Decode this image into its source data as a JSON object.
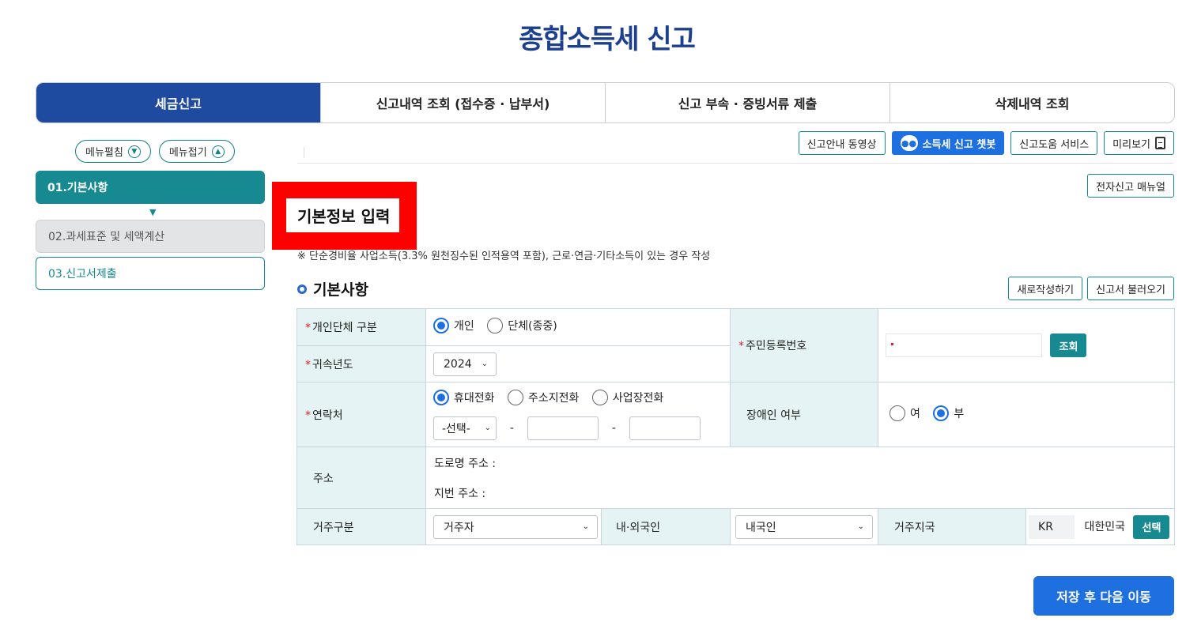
{
  "page_title": "종합소득세 신고",
  "tabs": [
    {
      "label": "세금신고"
    },
    {
      "label": "신고내역 조회 (접수증 · 납부서)"
    },
    {
      "label": "신고 부속 · 증빙서류 제출"
    },
    {
      "label": "삭제내역 조회"
    }
  ],
  "sidebar": {
    "expand_label": "메뉴펼침",
    "collapse_label": "메뉴접기",
    "steps": [
      {
        "label": "01.기본사항"
      },
      {
        "label": "02.과세표준 및 세액계산"
      },
      {
        "label": "03.신고서제출"
      }
    ]
  },
  "toolbar": {
    "video_guide": "신고안내 동영상",
    "chatbot": "소득세 신고 챗봇",
    "help_service": "신고도움 서비스",
    "preview": "미리보기",
    "manual": "전자신고 매뉴얼"
  },
  "section": {
    "heading": "기본정보 입력",
    "note": "※ 단순경비율 사업소득(3.3% 원천징수된 인적용역 포함), 근로·연금·기타소득이 있는 경우 작성",
    "title": "기본사항",
    "new_write": "새로작성하기",
    "load_return": "신고서 불러오기"
  },
  "form": {
    "type_label": "개인단체 구분",
    "type_options": [
      "개인",
      "단체(종중)"
    ],
    "type_selected": "개인",
    "year_label": "귀속년도",
    "year_value": "2024",
    "rrn_label": "주민등록번호",
    "lookup_btn": "조회",
    "contact_label": "연락처",
    "contact_options": [
      "휴대전화",
      "주소지전화",
      "사업장전화"
    ],
    "contact_selected": "휴대전화",
    "phone_prefix": "-선택-",
    "phone_dash": "-",
    "disabled_label": "장애인 여부",
    "disabled_options": [
      "여",
      "부"
    ],
    "disabled_selected": "부",
    "address_label": "주소",
    "road_address": "도로명 주소 :",
    "lot_address": "지번 주소 :",
    "residence_label": "거주구분",
    "residence_value": "거주자",
    "nationality_label": "내·외국인",
    "nationality_value": "내국인",
    "country_label": "거주지국",
    "country_code": "KR",
    "country_name": "대한민국",
    "select_btn": "선택"
  },
  "next_button": "저장 후 다음 이동",
  "colors": {
    "primary_blue": "#1e4aa0",
    "teal": "#178a91",
    "action_blue": "#1e6fe0",
    "highlight_red": "#ff0000"
  }
}
